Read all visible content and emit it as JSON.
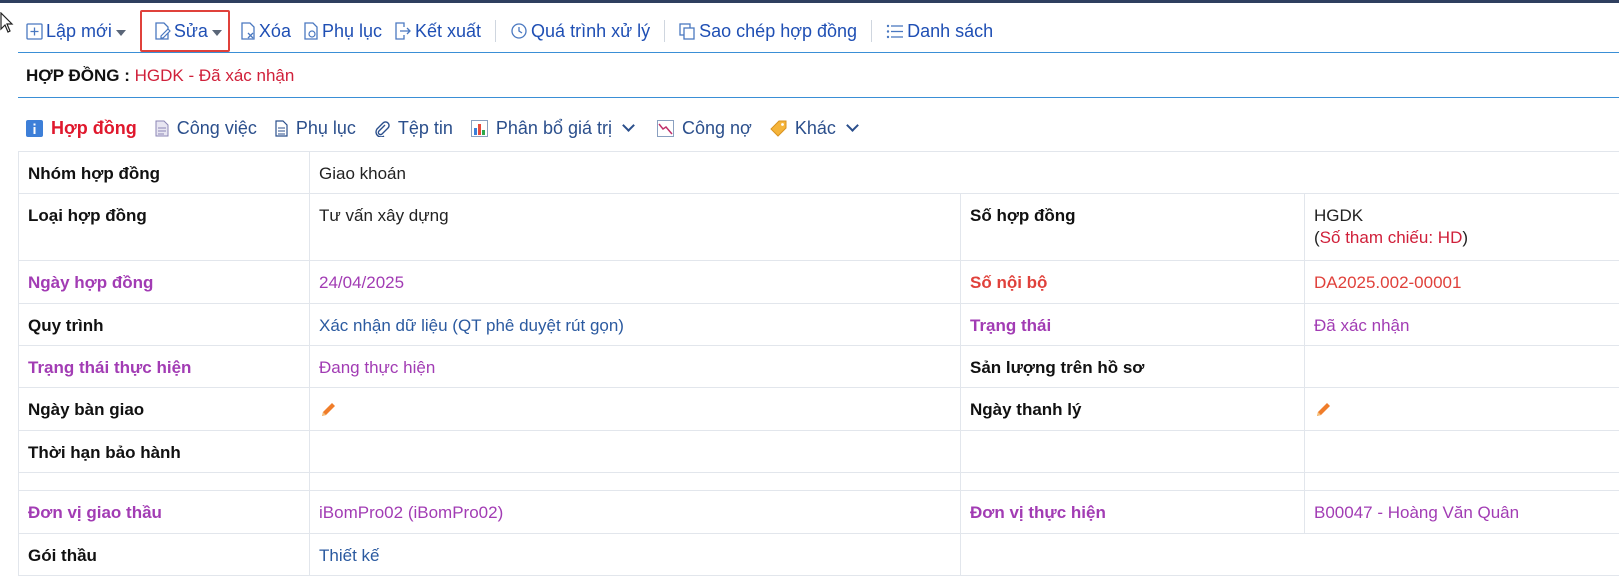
{
  "toolbar": {
    "new_label": "Lập mới",
    "edit_label": "Sửa",
    "delete_label": "Xóa",
    "appendix_label": "Phụ lục",
    "export_label": "Kết xuất",
    "process_label": "Quá trình xử lý",
    "copy_label": "Sao chép hợp đồng",
    "list_label": "Danh sách"
  },
  "header": {
    "label": "HỢP ĐỒNG :",
    "value": "HGDK - Đã xác nhận"
  },
  "tabs": [
    {
      "label": "Hợp đồng",
      "icon": "info-icon"
    },
    {
      "label": "Công việc",
      "icon": "document-icon"
    },
    {
      "label": "Phụ lục",
      "icon": "file-icon"
    },
    {
      "label": "Tệp tin",
      "icon": "paperclip-icon"
    },
    {
      "label": "Phân bổ giá trị",
      "icon": "bar-chart-icon"
    },
    {
      "label": "Công nợ",
      "icon": "line-chart-icon"
    },
    {
      "label": "Khác",
      "icon": "tag-icon"
    }
  ],
  "fields": {
    "group_label": "Nhóm hợp đồng",
    "group_value": "Giao khoán",
    "type_label": "Loại hợp đồng",
    "type_value": "Tư vấn xây dựng",
    "number_label": "Số hợp đồng",
    "number_value": "HGDK",
    "ref_open": "(",
    "ref_value": "Số tham chiếu: HD",
    "ref_close": ")",
    "date_label": "Ngày hợp đồng",
    "date_value": "24/04/2025",
    "internal_label": "Số nội bộ",
    "internal_value": "DA2025.002-00001",
    "workflow_label": "Quy trình",
    "workflow_value": "Xác nhận dữ liệu (QT phê duyệt rút gọn)",
    "status_label": "Trạng thái",
    "status_value": "Đã xác nhận",
    "exec_status_label": "Trạng thái thực hiện",
    "exec_status_value": "Đang thực hiện",
    "output_label": "Sản lượng trên hồ sơ",
    "output_value": "",
    "handover_label": "Ngày bàn giao",
    "liquidation_label": "Ngày thanh lý",
    "warranty_label": "Thời hạn bảo hành",
    "contractor_label": "Đơn vị giao thầu",
    "contractor_value": "iBomPro02 (iBomPro02)",
    "executor_label": "Đơn vị thực hiện",
    "executor_value": "B00047 - Hoàng Văn Quân",
    "package_label": "Gói thầu",
    "package_value": "Thiết kế"
  },
  "colors": {
    "link_blue": "#1f4fb4",
    "active_red": "#e0182d",
    "purple": "#a23cb4",
    "edit_outline": "#e0413b",
    "pencil_orange": "#f07d2a"
  }
}
